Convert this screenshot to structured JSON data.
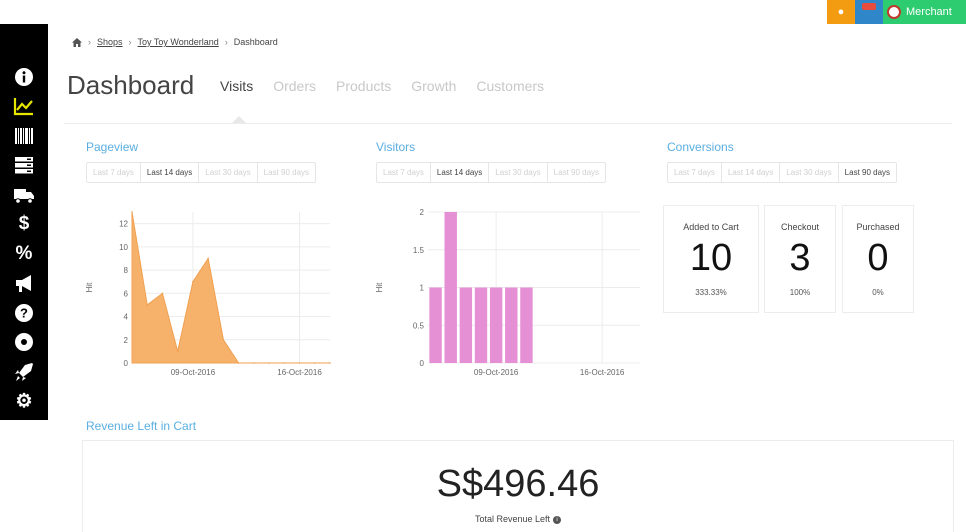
{
  "toolbar": {
    "merchant_label": "Merchant",
    "colors": {
      "orange": "#f39c12",
      "blue": "#2f86c8",
      "green": "#2ecc71"
    }
  },
  "sidebar": {
    "items": [
      {
        "icon": "info-icon",
        "glyph": "ℹ"
      },
      {
        "icon": "line-chart-icon",
        "active": true
      },
      {
        "icon": "barcode-icon"
      },
      {
        "icon": "server-icon"
      },
      {
        "icon": "truck-icon"
      },
      {
        "icon": "dollar-icon",
        "glyph": "$"
      },
      {
        "icon": "percent-icon",
        "glyph": "%"
      },
      {
        "icon": "megaphone-icon"
      },
      {
        "icon": "question-icon",
        "glyph": "?"
      },
      {
        "icon": "disc-icon"
      },
      {
        "icon": "rocket-icon"
      },
      {
        "icon": "gear-icon",
        "glyph": "⚙"
      }
    ]
  },
  "breadcrumb": {
    "home_icon": "home-icon",
    "items": [
      "Shops",
      "Toy Toy Wonderland",
      "Dashboard"
    ]
  },
  "page": {
    "title": "Dashboard",
    "tabs": [
      "Visits",
      "Orders",
      "Products",
      "Growth",
      "Customers"
    ],
    "active_tab": "Visits"
  },
  "pageview": {
    "title": "Pageview",
    "ranges": [
      "Last 7 days",
      "Last 14 days",
      "Last 30 days",
      "Last 90 days"
    ],
    "selected": "Last 14 days"
  },
  "visitors": {
    "title": "Visitors",
    "ranges": [
      "Last 7 days",
      "Last 14 days",
      "Last 30 days",
      "Last 90 days"
    ],
    "selected": "Last 14 days"
  },
  "conversions": {
    "title": "Conversions",
    "ranges": [
      "Last 7 days",
      "Last 14 days",
      "Last 30 days",
      "Last 90 days"
    ],
    "selected": "Last 90 days",
    "kpis": [
      {
        "label": "Added to Cart",
        "value": "10",
        "pct": "333.33%"
      },
      {
        "label": "Checkout",
        "value": "3",
        "pct": "100%"
      },
      {
        "label": "Purchased",
        "value": "0",
        "pct": "0%"
      }
    ]
  },
  "revenue": {
    "section_title": "Revenue Left in Cart",
    "value": "S$496.46",
    "label": "Total Revenue Left"
  },
  "chart_data": [
    {
      "type": "area",
      "title": "",
      "ylabel": "Hit",
      "ylim": [
        0,
        13
      ],
      "yticks": [
        0,
        2,
        4,
        6,
        8,
        10,
        12
      ],
      "xtick_labels": [
        {
          "label": "09-Oct-2016",
          "day": 4
        },
        {
          "label": "16-Oct-2016",
          "day": 11
        }
      ],
      "x_days": [
        0,
        1,
        2,
        3,
        4,
        5,
        6,
        7,
        8,
        9,
        10,
        11,
        12,
        13
      ],
      "values": [
        13,
        5,
        6,
        1,
        7,
        9,
        2,
        0,
        0,
        0,
        0,
        0,
        0,
        0
      ],
      "color": "#f6b26b",
      "grid": true
    },
    {
      "type": "bar",
      "title": "",
      "ylabel": "Hit",
      "ylim": [
        0,
        2
      ],
      "yticks": [
        0,
        0.5,
        1,
        1.5,
        2
      ],
      "xtick_labels": [
        {
          "label": "09-Oct-2016",
          "day": 4
        },
        {
          "label": "16-Oct-2016",
          "day": 11
        }
      ],
      "x_days": [
        0,
        1,
        2,
        3,
        4,
        5,
        6,
        7,
        8,
        9,
        10,
        11,
        12,
        13
      ],
      "values": [
        1,
        2,
        1,
        1,
        1,
        1,
        1,
        0,
        0,
        0,
        0,
        0,
        0,
        0
      ],
      "color": "#e58fd4",
      "grid": true
    }
  ]
}
